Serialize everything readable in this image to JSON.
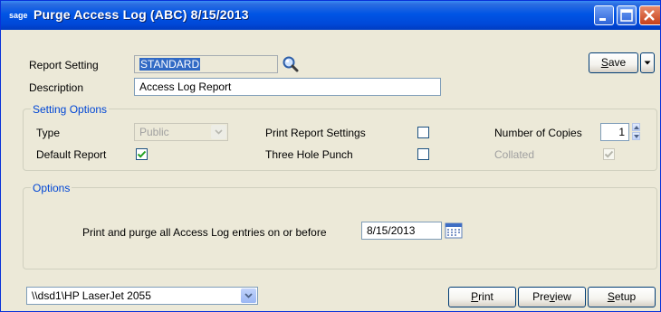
{
  "window": {
    "logo": "sage",
    "title": "Purge Access Log (ABC) 8/15/2013"
  },
  "report_setting": {
    "label": "Report Setting",
    "value": "STANDARD"
  },
  "description": {
    "label": "Description",
    "value": "Access Log Report"
  },
  "save_button": {
    "pre": "",
    "accel": "S",
    "post": "ave"
  },
  "setting_options": {
    "title": "Setting Options",
    "type_label": "Type",
    "type_value": "Public",
    "default_report_label": "Default Report",
    "default_report_checked": true,
    "print_report_settings_label": "Print Report Settings",
    "print_report_settings_checked": false,
    "three_hole_punch_label": "Three Hole Punch",
    "three_hole_punch_checked": false,
    "number_of_copies_label": "Number of Copies",
    "number_of_copies_value": "1",
    "collated_label": "Collated",
    "collated_checked": true
  },
  "options": {
    "title": "Options",
    "purge_label": "Print and purge all Access Log entries on or before",
    "purge_date": "8/15/2013"
  },
  "printer": {
    "value": "\\\\dsd1\\HP LaserJet 2055"
  },
  "buttons": {
    "print": {
      "pre": "",
      "accel": "P",
      "post": "rint"
    },
    "preview": {
      "pre": "Pre",
      "accel": "v",
      "post": "iew"
    },
    "setup": {
      "pre": "",
      "accel": "S",
      "post": "etup"
    }
  },
  "colors": {
    "titlebar": "#0055E5",
    "group_title": "#0046D5",
    "selection": "#316AC5",
    "checkmark": "#21A121"
  }
}
